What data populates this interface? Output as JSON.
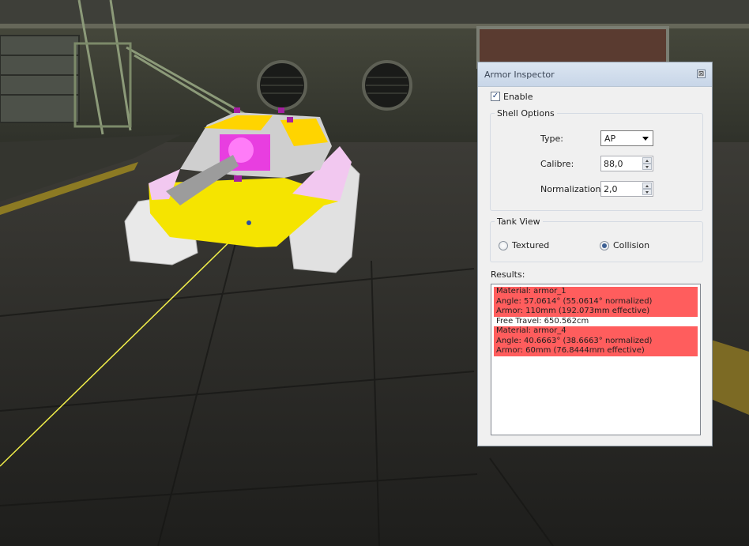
{
  "window": {
    "title": "Armor Inspector",
    "close_glyph": "⊠"
  },
  "enable": {
    "label": "Enable",
    "checked": true,
    "check_glyph": "✓"
  },
  "shell_options": {
    "group_label": "Shell Options",
    "type_label": "Type:",
    "type_value": "AP",
    "calibre_label": "Calibre:",
    "calibre_value": "88,0",
    "normalization_label": "Normalization:",
    "normalization_value": "2,0"
  },
  "tank_view": {
    "group_label": "Tank View",
    "options": [
      {
        "label": "Textured",
        "selected": false
      },
      {
        "label": "Collision",
        "selected": true
      }
    ]
  },
  "results": {
    "label": "Results:",
    "entries": [
      {
        "kind": "hit",
        "lines": [
          "Material: armor_1",
          "Angle: 57.0614° (55.0614° normalized)",
          "Armor: 110mm (192.073mm effective)"
        ]
      },
      {
        "kind": "free",
        "lines": [
          "Free Travel: 650.562cm"
        ]
      },
      {
        "kind": "hit",
        "lines": [
          "Material: armor_4",
          "Angle: 40.6663° (38.6663° normalized)",
          "Armor: 60mm (76.8444mm effective)"
        ]
      }
    ]
  },
  "colors": {
    "hit_highlight": "#ff5d5d",
    "tank_collision_yellow": "#f5e400",
    "tank_collision_magenta": "#e83ee0",
    "shell_trace": "#f3f04a"
  }
}
